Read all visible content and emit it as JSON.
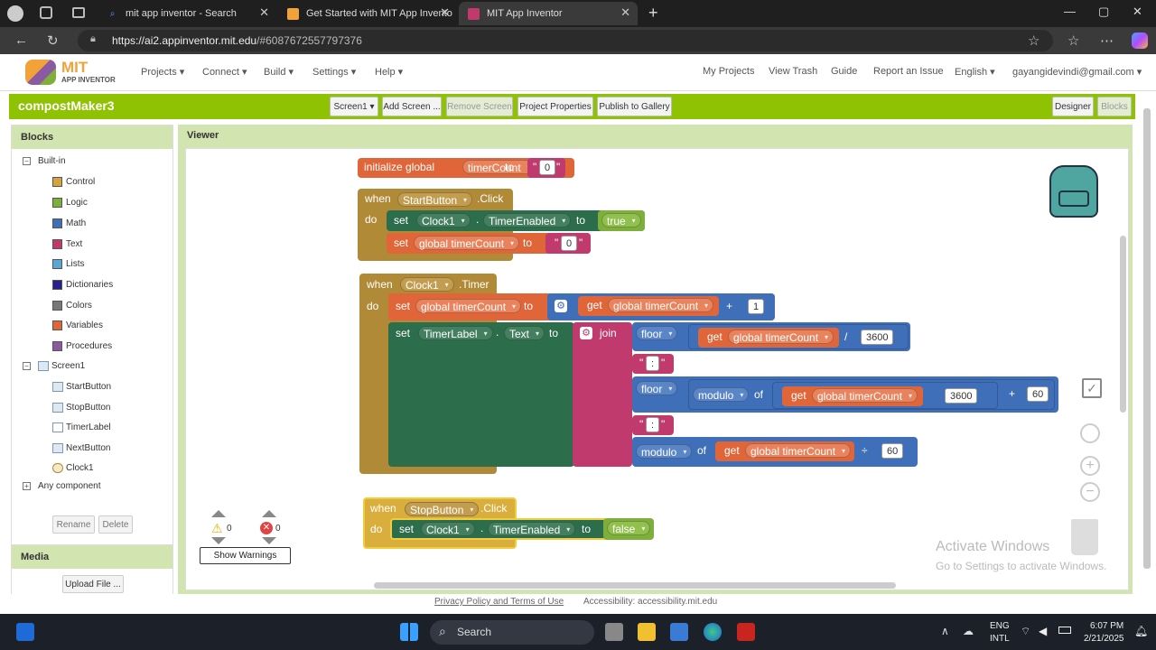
{
  "browser": {
    "tabs": [
      {
        "label": "mit app inventor - Search"
      },
      {
        "label": "Get Started with MIT App Invento"
      },
      {
        "label": "MIT App Inventor"
      }
    ],
    "url_host": "https://ai2.appinventor.mit.edu",
    "url_path": "/#6087672557797376"
  },
  "menu": {
    "logo_top": "MIT",
    "logo_bottom": "APP INVENTOR",
    "items": [
      "Projects ▾",
      "Connect ▾",
      "Build ▾",
      "Settings ▾",
      "Help ▾"
    ],
    "right": [
      "My Projects",
      "View Trash",
      "Guide",
      "Report an Issue",
      "English ▾",
      "gayangidevindi@gmail.com ▾"
    ]
  },
  "project": {
    "name": "compostMaker3",
    "screen": "Screen1 ▾",
    "add_screen": "Add Screen ...",
    "remove_screen": "Remove Screen",
    "properties": "Project Properties",
    "publish": "Publish to Gallery",
    "designer": "Designer",
    "blocks": "Blocks"
  },
  "blocks_panel": {
    "title": "Blocks",
    "builtin": "Built-in",
    "builtins": [
      {
        "label": "Control",
        "color": "#d4a43e"
      },
      {
        "label": "Logic",
        "color": "#7faf3b"
      },
      {
        "label": "Math",
        "color": "#3f6fb8"
      },
      {
        "label": "Text",
        "color": "#c13a6d"
      },
      {
        "label": "Lists",
        "color": "#59a7d6"
      },
      {
        "label": "Dictionaries",
        "color": "#2a1f8f"
      },
      {
        "label": "Colors",
        "color": "#777777"
      },
      {
        "label": "Variables",
        "color": "#e0663a"
      },
      {
        "label": "Procedures",
        "color": "#8a5aa3"
      }
    ],
    "screen": "Screen1",
    "components": [
      "StartButton",
      "StopButton",
      "TimerLabel",
      "NextButton",
      "Clock1"
    ],
    "any": "Any component",
    "rename": "Rename",
    "delete": "Delete"
  },
  "media_panel": {
    "title": "Media",
    "upload": "Upload File ..."
  },
  "viewer": {
    "title": "Viewer",
    "warn_count": "0",
    "err_count": "0",
    "show_warnings": "Show Warnings",
    "watermark_title": "Activate Windows",
    "watermark_sub": "Go to Settings to activate Windows."
  },
  "code": {
    "init": {
      "kw": "initialize global",
      "var": "timerCount",
      "to": "to",
      "val": "0"
    },
    "start": {
      "when": "when",
      "comp": "StartButton",
      "event": ".Click",
      "do": "do",
      "set": "set",
      "clock": "Clock1",
      "dot": ".",
      "prop": "TimerEnabled",
      "to": "to",
      "true": "true",
      "var": "global timerCount",
      "zero": "0"
    },
    "timer": {
      "when": "when",
      "comp": "Clock1",
      "event": ".Timer",
      "do": "do",
      "set": "set",
      "var": "global timerCount",
      "to": "to",
      "get": "get",
      "plus": "+",
      "one": "1",
      "label": "TimerLabel",
      "dot": ".",
      "text": "Text",
      "join": "join",
      "floor": "floor",
      "div": "/",
      "n3600": "3600",
      "colon": ":",
      "modulo": "modulo",
      "of": "of",
      "n60": "60",
      "divsym": "÷"
    },
    "stop": {
      "when": "when",
      "comp": "StopButton",
      "event": ".Click",
      "do": "do",
      "set": "set",
      "clock": "Clock1",
      "dot": ".",
      "prop": "TimerEnabled",
      "to": "to",
      "false": "false"
    }
  },
  "footer": {
    "privacy": "Privacy Policy and Terms of Use",
    "access": "Accessibility: accessibility.mit.edu"
  },
  "taskbar": {
    "search": "Search",
    "lang1": "ENG",
    "lang2": "INTL",
    "time": "6:07 PM",
    "date": "2/21/2025"
  },
  "colors": {
    "green_bar": "#8fc202",
    "event": "#b08a36",
    "setter": "#e0663a",
    "component": "#2c6d4c",
    "math": "#3f6fb8",
    "text": "#c13a6d",
    "logic": "#7faf3b"
  }
}
